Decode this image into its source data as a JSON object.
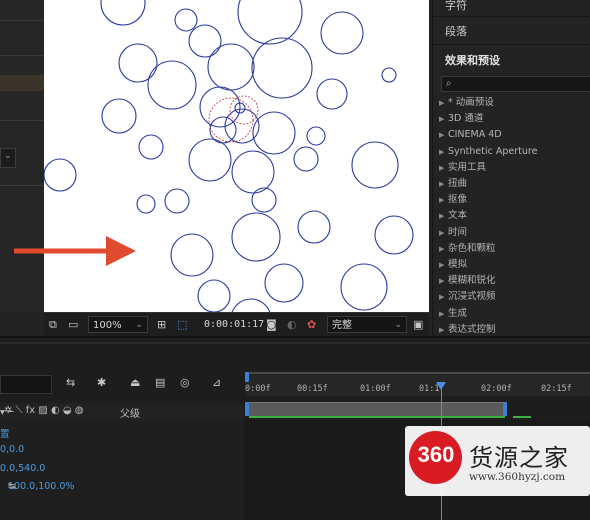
{
  "viewer": {
    "zoom": "100%",
    "timecode": "0:00:01:17",
    "quality": "完整"
  },
  "right_panel": {
    "character_tab": "字符",
    "paragraph_tab": "段落",
    "effects_title": "效果和预设",
    "search_icon": "⌕",
    "effects": [
      "* 动画预设",
      "3D 通道",
      "CINEMA 4D",
      "Synthetic Aperture",
      "实用工具",
      "扭曲",
      "抠像",
      "文本",
      "时间",
      "杂色和颗粒",
      "模拟",
      "模糊和锐化",
      "沉浸式视频",
      "生成",
      "表达式控制"
    ]
  },
  "timeline": {
    "ruler_ticks": [
      "0:00f",
      "00:15f",
      "01:00f",
      "01:1",
      "02:00f",
      "02:15f"
    ],
    "parent_label": "父级",
    "props": {
      "p1": "置",
      "p2": "0,0.0",
      "p3": "0.0,540.0",
      "p4": "100.0,100.0%"
    }
  },
  "watermark": {
    "number": "360",
    "title": "货源之家",
    "url": "www.360hyzj.com"
  },
  "colors": {
    "circle_stroke": "#2a3a9e",
    "arrow": "#e04a2f",
    "playhead": "#4a90e2",
    "keyframe_bar": "#3cb043"
  }
}
